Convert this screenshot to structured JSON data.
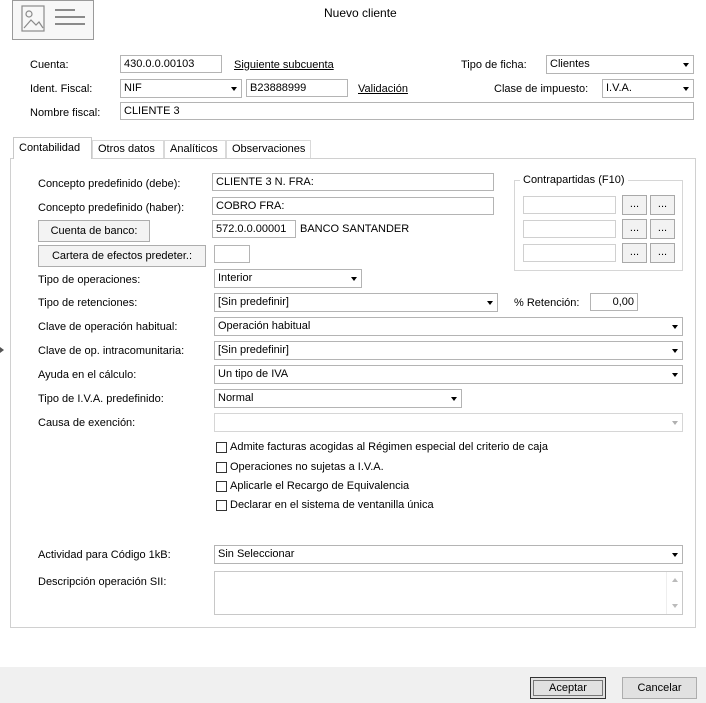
{
  "window": {
    "title": "Nuevo cliente"
  },
  "header": {
    "cuenta_label": "Cuenta:",
    "cuenta_value": "430.0.0.00103",
    "siguiente_link": "Siguiente subcuenta",
    "tipo_ficha_label": "Tipo de ficha:",
    "tipo_ficha_value": "Clientes",
    "ident_label": "Ident. Fiscal:",
    "ident_tipo": "NIF",
    "ident_value": "B23888999",
    "validacion_link": "Validación",
    "clase_impuesto_label": "Clase de impuesto:",
    "clase_impuesto_value": "I.V.A.",
    "nombre_label": "Nombre fiscal:",
    "nombre_value": "CLIENTE 3"
  },
  "tabs": [
    {
      "label": "Contabilidad"
    },
    {
      "label": "Otros datos"
    },
    {
      "label": "Analíticos"
    },
    {
      "label": "Observaciones"
    }
  ],
  "contabilidad": {
    "concepto_debe_label": "Concepto predefinido (debe):",
    "concepto_debe_value": "CLIENTE 3 N. FRA:",
    "concepto_haber_label": "Concepto predefinido (haber):",
    "concepto_haber_value": "COBRO FRA:",
    "cuenta_banco_button": "Cuenta de banco:",
    "cuenta_banco_value": "572.0.0.00001",
    "cuenta_banco_name": "BANCO SANTANDER",
    "cartera_button": "Cartera de efectos predeter.:",
    "cartera_value": "",
    "contrapartidas_title": "Contrapartidas (F10)",
    "dots_label": "...",
    "tipo_operaciones_label": "Tipo de operaciones:",
    "tipo_operaciones_value": "Interior",
    "tipo_retenciones_label": "Tipo de retenciones:",
    "tipo_retenciones_value": "[Sin predefinir]",
    "retencion_label": "% Retención:",
    "retencion_value": "0,00",
    "clave_operacion_label": "Clave de operación habitual:",
    "clave_operacion_value": "Operación habitual",
    "clave_intra_label": "Clave de op. intracomunitaria:",
    "clave_intra_value": "[Sin predefinir]",
    "ayuda_label": "Ayuda en el cálculo:",
    "ayuda_value": "Un tipo de IVA",
    "tipo_iva_label": "Tipo de I.V.A. predefinido:",
    "tipo_iva_value": "Normal",
    "causa_label": "Causa de exención:",
    "causa_value": "",
    "checkboxes": [
      {
        "label": "Admite facturas acogidas al Régimen especial del criterio de caja"
      },
      {
        "label": "Operaciones no sujetas a I.V.A."
      },
      {
        "label": "Aplicarle el Recargo de Equivalencia"
      },
      {
        "label": "Declarar en el sistema de ventanilla única"
      }
    ],
    "actividad_label": "Actividad para Código 1kB:",
    "actividad_value": "Sin Seleccionar",
    "descripcion_label": "Descripción operación SII:",
    "descripcion_value": ""
  },
  "footer": {
    "accept_button": "Aceptar",
    "cancel_button": "Cancelar"
  }
}
